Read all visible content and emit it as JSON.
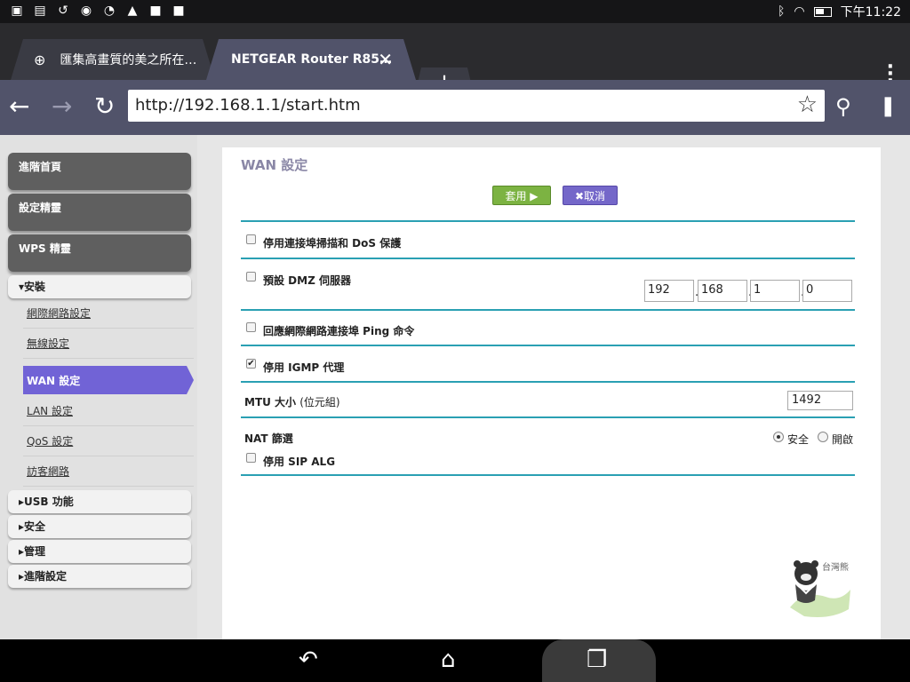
{
  "status_bar": {
    "icons": [
      "image-icon",
      "asus-icon",
      "history-icon",
      "app-icon",
      "speed-icon",
      "warning-icon",
      "bag-icon",
      "bag-check-icon"
    ],
    "right_icons": [
      "bluetooth-icon",
      "wifi-icon",
      "battery-icon"
    ],
    "time": "下午11:22"
  },
  "tabs": [
    {
      "title": "匯集高畫質的美之所在…",
      "active": false
    },
    {
      "title": "NETGEAR Router R85…",
      "active": true
    }
  ],
  "toolbar": {
    "url": "http://192.168.1.1/start.htm"
  },
  "sidebar": {
    "top_items": [
      "進階首頁",
      "設定精靈",
      "WPS 精靈"
    ],
    "section_open": "▾安裝",
    "sub_items": [
      "網際網路設定",
      "無線設定",
      "WAN 設定",
      "LAN 設定",
      "QoS 設定",
      "訪客網路"
    ],
    "active_sub": "WAN 設定",
    "bottom_items": [
      "▸USB 功能",
      "▸安全",
      "▸管理",
      "▸進階設定"
    ]
  },
  "content": {
    "title": "WAN 設定",
    "apply_label": "套用 ▶",
    "cancel_label": "✖取消",
    "dos_label": "停用連接埠掃描和 DoS 保護",
    "dmz_label": "預設 DMZ 伺服器",
    "dmz_ip": [
      "192",
      "168",
      "1",
      "0"
    ],
    "ping_label": "回應網際網路連接埠 Ping 命令",
    "igmp_label": "停用 IGMP 代理",
    "mtu_label": "MTU 大小",
    "mtu_unit": "(位元組)",
    "mtu_value": "1492",
    "nat_label": "NAT 篩選",
    "nat_options": [
      "安全",
      "開啟"
    ],
    "nat_selected": "安全",
    "sip_label": "停用 SIP ALG",
    "checkboxes": {
      "dos": false,
      "dmz": false,
      "ping": false,
      "igmp": true,
      "sip": false
    }
  },
  "watermark": {
    "text": "台灣熊"
  },
  "navbar": {
    "icons": [
      "back-icon",
      "home-icon",
      "recents-icon"
    ]
  }
}
